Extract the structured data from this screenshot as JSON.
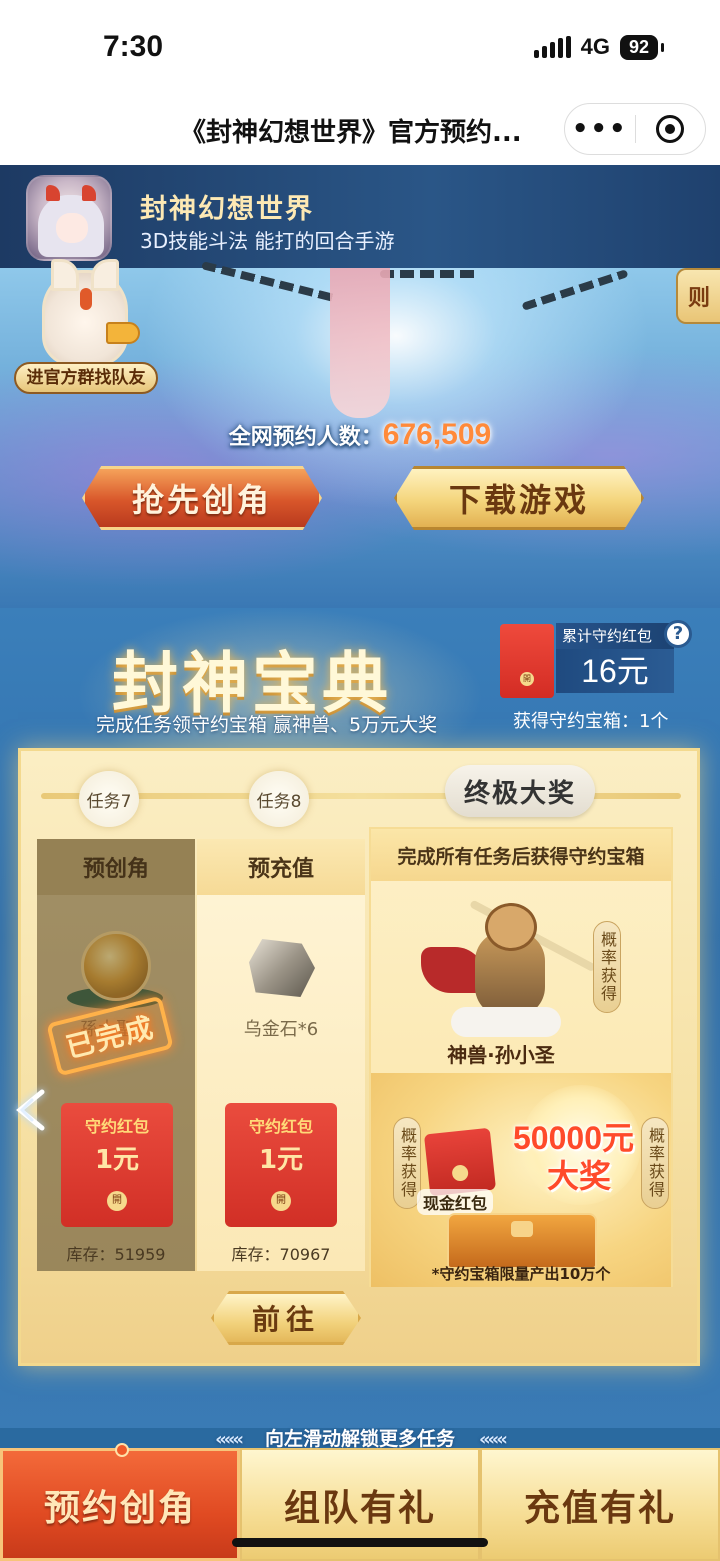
{
  "status_bar": {
    "time": "7:30",
    "network": "4G",
    "battery": "92"
  },
  "nav": {
    "title": "《封神幻想世界》官方预约...",
    "more_icon": "more-dots-icon",
    "close_icon": "close-target-icon"
  },
  "game": {
    "name": "封神幻想世界",
    "slogan": "3D技能斗法 能打的回合手游"
  },
  "hero": {
    "rules_tab": "则",
    "group_badge_label": "进官方群找队友",
    "reserve_label": "全网预约人数：",
    "reserve_count": "676,509",
    "btn_create_role": "抢先创角",
    "btn_download": "下载游戏"
  },
  "codex": {
    "title": "封神宝典",
    "subtitle": "完成任务领守约宝箱 赢神兽、5万元大奖",
    "accum_label": "累计守约红包",
    "accum_value": "16元",
    "box_count_text": "获得守约宝箱：1个",
    "envelope_seal": "開"
  },
  "board": {
    "nodes": [
      {
        "label": "任务7"
      },
      {
        "label": "任务8"
      }
    ],
    "final_tag": "终极大奖",
    "tasks": [
      {
        "title": "预创角",
        "item_name": "孫大聖…",
        "done_stamp": "已完成",
        "redpack_title": "守约红包",
        "redpack_amount": "1元",
        "seal": "開",
        "stock": "库存：51959"
      },
      {
        "title": "预充值",
        "item_name": "乌金石*6",
        "redpack_title": "守约红包",
        "redpack_amount": "1元",
        "seal": "開",
        "stock": "库存：70967"
      }
    ],
    "final": {
      "header": "完成所有任务后获得守约宝箱",
      "prob_tag": "概率获得",
      "beast_name": "神兽·孙小圣",
      "grand_amount": "50000元",
      "grand_label": "大奖",
      "cash_label": "现金红包",
      "chest_note": "*守约宝箱限量产出10万个"
    },
    "go_button": "前往"
  },
  "swipe_hint": {
    "text": "向左滑动解锁更多任务",
    "arrows": "«««"
  },
  "tabs": [
    {
      "label": "预约创角",
      "active": true
    },
    {
      "label": "组队有礼",
      "active": false
    },
    {
      "label": "充值有礼",
      "active": false
    }
  ],
  "colors": {
    "accent_orange": "#e04a22",
    "gold": "#f6dd94",
    "reserve_count": "#ff8a3a",
    "grand_prize": "#ff4a2a"
  }
}
